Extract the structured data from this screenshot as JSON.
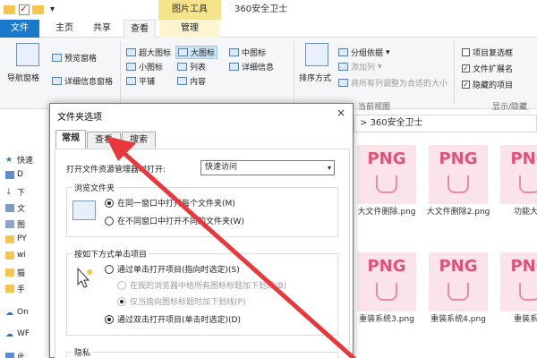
{
  "window": {
    "context_tab": "图片工具",
    "title": "360安全卫士"
  },
  "ribbon_tabs": {
    "file": "文件",
    "home": "主页",
    "share": "共享",
    "view": "查看",
    "manage": "管理"
  },
  "ribbon": {
    "navigation_pane": "导航窗格",
    "preview_pane": "预览窗格",
    "details_pane": "详细信息窗格",
    "layout": {
      "extra_large_icons": "超大图标",
      "large_icons": "大图标",
      "medium_icons": "中图标",
      "small_icons": "小图标",
      "list": "列表",
      "details": "详细信息",
      "tiles": "平铺",
      "content": "内容"
    },
    "sort_by": "排序方式",
    "group_by": "分组依据",
    "add_columns": "添加列",
    "size_all_columns": "将所有列调整为合适的大小",
    "current_view_label": "当前视图",
    "item_check_boxes": "项目复选框",
    "file_name_extensions": "文件扩展名",
    "hidden_items": "隐藏的项目",
    "show_hide_label": "显示/隐藏",
    "item_check_boxes_checked": false,
    "file_name_extensions_checked": true,
    "hidden_items_checked": true
  },
  "address": {
    "path": "360安全卫士"
  },
  "nav_pane": {
    "items": [
      "快速",
      "D",
      "下",
      "文",
      "图",
      "PY",
      "wi",
      "猫",
      "手",
      "On",
      "WF",
      "此"
    ]
  },
  "files": [
    {
      "icon_text": "PNG",
      "name": "大文件删除.png"
    },
    {
      "icon_text": "PNG",
      "name": "大文件删除2.png"
    },
    {
      "icon_text": "PNG",
      "name": "功能大全"
    },
    {
      "icon_text": "PNG",
      "name": "重装系统3.png"
    },
    {
      "icon_text": "PNG",
      "name": "重装系统4.png"
    },
    {
      "icon_text": "PNG",
      "name": "重装系统"
    }
  ],
  "dialog": {
    "title": "文件夹选项",
    "close": "×",
    "tabs": [
      "常规",
      "查看",
      "搜索"
    ],
    "open_explorer_label": "打开文件资源管理器时打开:",
    "open_explorer_value": "快速访问",
    "browse_folders": {
      "legend": "浏览文件夹",
      "same_window": "在同一窗口中打开每个文件夹(M)",
      "new_window": "在不同窗口中打开不同的文件夹(W)"
    },
    "click_items": {
      "legend": "按如下方式单击项目",
      "single_click": "通过单击打开项目(指向时选定)(S)",
      "underline_browser": "在我的浏览器中给所有图标标题加下划线(B)",
      "underline_point": "仅当指向图标标题时加下划线(P)",
      "double_click": "通过双击打开项目(单击时选定)(D)"
    },
    "privacy_legend": "隐私"
  },
  "colors": {
    "file_tab": "#1979ca",
    "context_tab": "#f6e48a",
    "png_text": "#e0527a",
    "arrow": "#e8383d"
  }
}
